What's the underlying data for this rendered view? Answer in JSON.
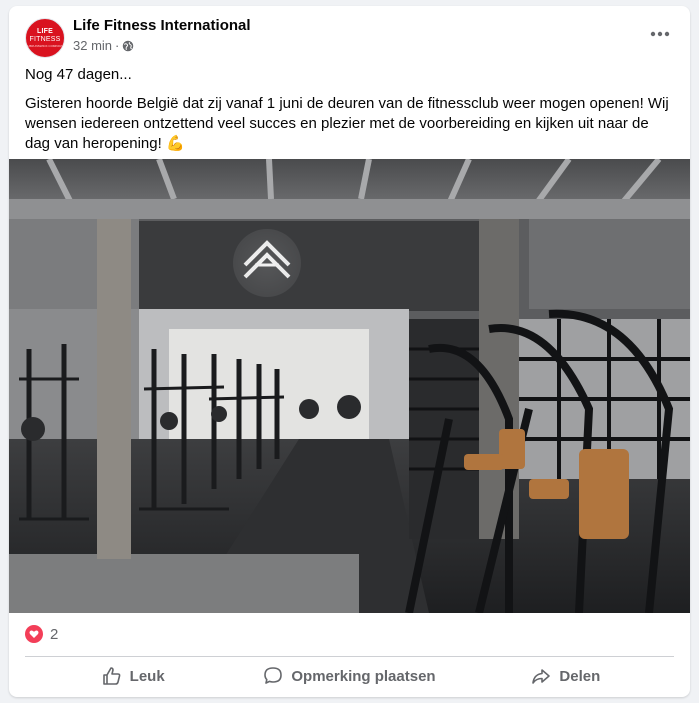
{
  "post": {
    "author": "Life Fitness International",
    "avatar": {
      "line1": "LIFE",
      "line2": "FITNESS",
      "line3": "A BRUNSWICK COMPANY"
    },
    "time": "32 min",
    "separator": "·",
    "audience_icon": "globe-icon",
    "menu_icon": "more-options-icon",
    "text_line1": "Nog 47 dagen...",
    "text_line2": "Gisteren hoorde België dat zij vanaf 1 juni de deuren van de fitnessclub weer mogen openen! Wij wensen iedereen ontzettend veel succes en plezier met de voorbereiding en kijken uit naar de dag van heropening! 💪",
    "photo_description_icon": "gym-photo"
  },
  "reactions": {
    "icon": "love-reaction-icon",
    "count": "2",
    "color": "#f33e58"
  },
  "actions": {
    "like": {
      "label": "Leuk",
      "icon": "thumbs-up-icon"
    },
    "comment": {
      "label": "Opmerking plaatsen",
      "icon": "comment-icon"
    },
    "share": {
      "label": "Delen",
      "icon": "share-icon"
    }
  },
  "colors": {
    "brand": "#d9121f",
    "muted": "#65676b",
    "background": "#f0f2f5"
  }
}
